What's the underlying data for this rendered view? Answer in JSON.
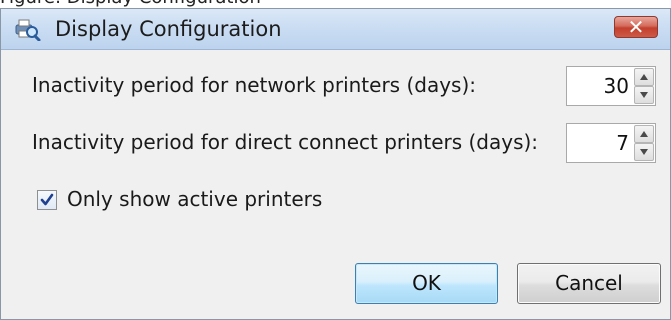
{
  "background_caption": "Figure: Display Configuration",
  "window": {
    "title": "Display Configuration",
    "icon": "printer-search-icon",
    "close_icon": "close-icon"
  },
  "fields": {
    "network_label": "Inactivity period for network printers (days):",
    "network_value": "30",
    "direct_label": "Inactivity period for direct connect printers (days):",
    "direct_value": "7"
  },
  "options": {
    "only_active_label": "Only show active printers",
    "only_active_checked": true
  },
  "buttons": {
    "ok_label": "OK",
    "cancel_label": "Cancel"
  },
  "colors": {
    "dialog_background": "#f0f0f0",
    "titlebar": "#c9dcf2",
    "close_button": "#c2402d",
    "ok_border": "#3c7fb1"
  }
}
